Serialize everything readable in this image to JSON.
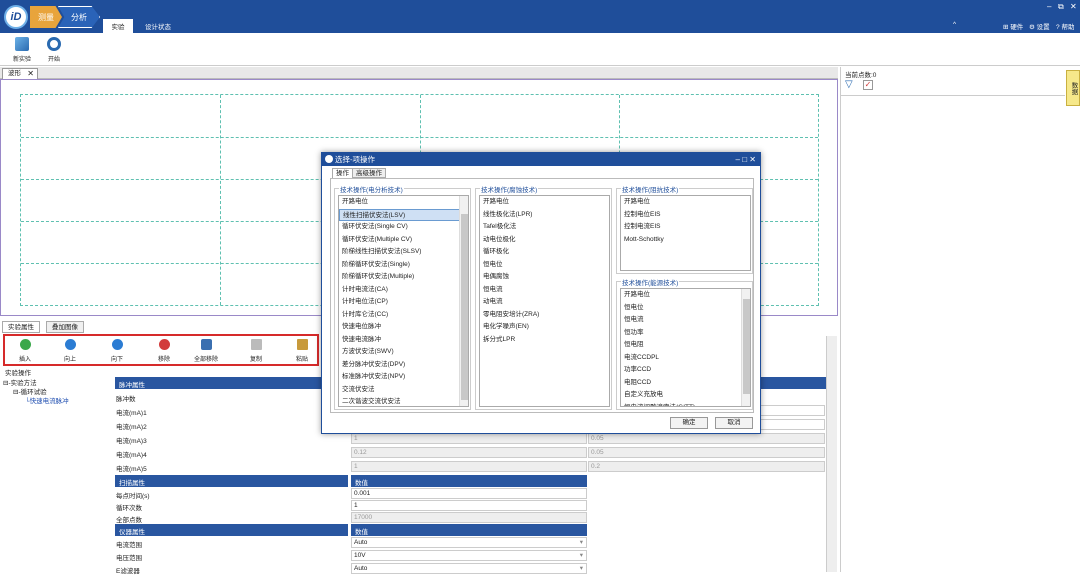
{
  "app": {
    "logo": "iD",
    "crumbs": [
      "测量",
      "分析"
    ],
    "tabs": [
      "实验",
      "设计状态"
    ],
    "window_controls": [
      "–",
      "⧉",
      "✕"
    ],
    "right_menu": {
      "collapse": "^",
      "hardware": "硬件",
      "settings": "设置",
      "help": "帮助"
    }
  },
  "ribbon": {
    "buttons": [
      {
        "label": "新实验",
        "icon": "new-experiment-icon"
      },
      {
        "label": "开始",
        "icon": "start-ring-icon"
      }
    ]
  },
  "waveform": {
    "tab_label": "波形",
    "close": "✕"
  },
  "right_panel": {
    "current_points_label": "当前点数:0",
    "side_tab": "数据"
  },
  "bottom": {
    "tabs": [
      "实验属性",
      "叠加图像"
    ],
    "toolbar": [
      {
        "label": "插入",
        "color": "#3aa84a"
      },
      {
        "label": "向上",
        "color": "#2b7cd3"
      },
      {
        "label": "向下",
        "color": "#2b7cd3"
      },
      {
        "label": "移除",
        "color": "#d23b3b"
      },
      {
        "label": "全部移除",
        "color": "#3a6fb0"
      },
      {
        "label": "复制",
        "color": "#999999"
      },
      {
        "label": "粘贴",
        "color": "#c89a3c"
      }
    ],
    "section_label": "实验操作",
    "tree": [
      "实验方法",
      "循环试验",
      "快速电流脉冲"
    ],
    "grid": {
      "pulse_header": "脉冲属性",
      "pulse_rows": [
        {
          "label": "脉冲数",
          "v1": "",
          "v2": ""
        },
        {
          "label": "电流(mA)1",
          "v1": "",
          "v2": ""
        },
        {
          "label": "电流(mA)2",
          "v1": "",
          "v2": ""
        },
        {
          "label": "电流(mA)3",
          "v1": "1",
          "v2": "0.05"
        },
        {
          "label": "电流(mA)4",
          "v1": "0.12",
          "v2": "0.05"
        },
        {
          "label": "电流(mA)5",
          "v1": "1",
          "v2": "0.2"
        }
      ],
      "scan_header": "扫描属性",
      "scan_value_header": "数值",
      "scan_rows": [
        {
          "label": "每点时间(s)",
          "value": "0.001"
        },
        {
          "label": "循环次数",
          "value": "1"
        },
        {
          "label": "全部点数",
          "value": "17000"
        }
      ],
      "inst_header": "仪器属性",
      "inst_value_header": "数值",
      "inst_rows": [
        {
          "label": "电流范围",
          "value": "Auto"
        },
        {
          "label": "电压范围",
          "value": "10V"
        },
        {
          "label": "E滤波器",
          "value": "Auto"
        }
      ]
    }
  },
  "dialog": {
    "title": "选择-项操作",
    "controls": [
      "–",
      "□",
      "✕"
    ],
    "tabs": [
      "操作",
      "高级操作"
    ],
    "group1": {
      "title": "技术操作(电分析技术)",
      "items": [
        "开路电位",
        "线性扫描伏安法(LSV)",
        "循环伏安法(Single CV)",
        "循环伏安法(Multiple CV)",
        "阶梯线性扫描伏安法(SLSV)",
        "阶梯循环伏安法(Single)",
        "阶梯循环伏安法(Multiple)",
        "计时电流法(CA)",
        "计时电位法(CP)",
        "计时库仑法(CC)",
        "快速电位脉冲",
        "快速电流脉冲",
        "方波伏安法(SWV)",
        "差分脉冲伏安法(DPV)",
        "标准脉冲伏安法(NPV)",
        "交流伏安法",
        "二次谐波交流伏安法"
      ],
      "selected": 1
    },
    "group2": {
      "title": "技术操作(腐蚀技术)",
      "items": [
        "开路电位",
        "线性极化法(LPR)",
        "Tafel极化法",
        "动电位极化",
        "循环极化",
        "恒电位",
        "电偶腐蚀",
        "恒电流",
        "动电流",
        "零电阻安培计(ZRA)",
        "电化学噪声(EN)",
        "拆分式LPR"
      ]
    },
    "group3": {
      "title": "技术操作(阻抗技术)",
      "items": [
        "开路电位",
        "控制电位EIS",
        "控制电流EIS",
        "Mott-Schottky"
      ]
    },
    "group4": {
      "title": "技术操作(能源技术)",
      "items": [
        "开路电位",
        "恒电位",
        "恒电流",
        "恒功率",
        "恒电阻",
        "电流CCDPL",
        "功率CCD",
        "电阻CCD",
        "自定义充放电",
        "恒电流间歇滴定法(GITT)"
      ]
    },
    "ok": "确定",
    "cancel": "取消"
  }
}
